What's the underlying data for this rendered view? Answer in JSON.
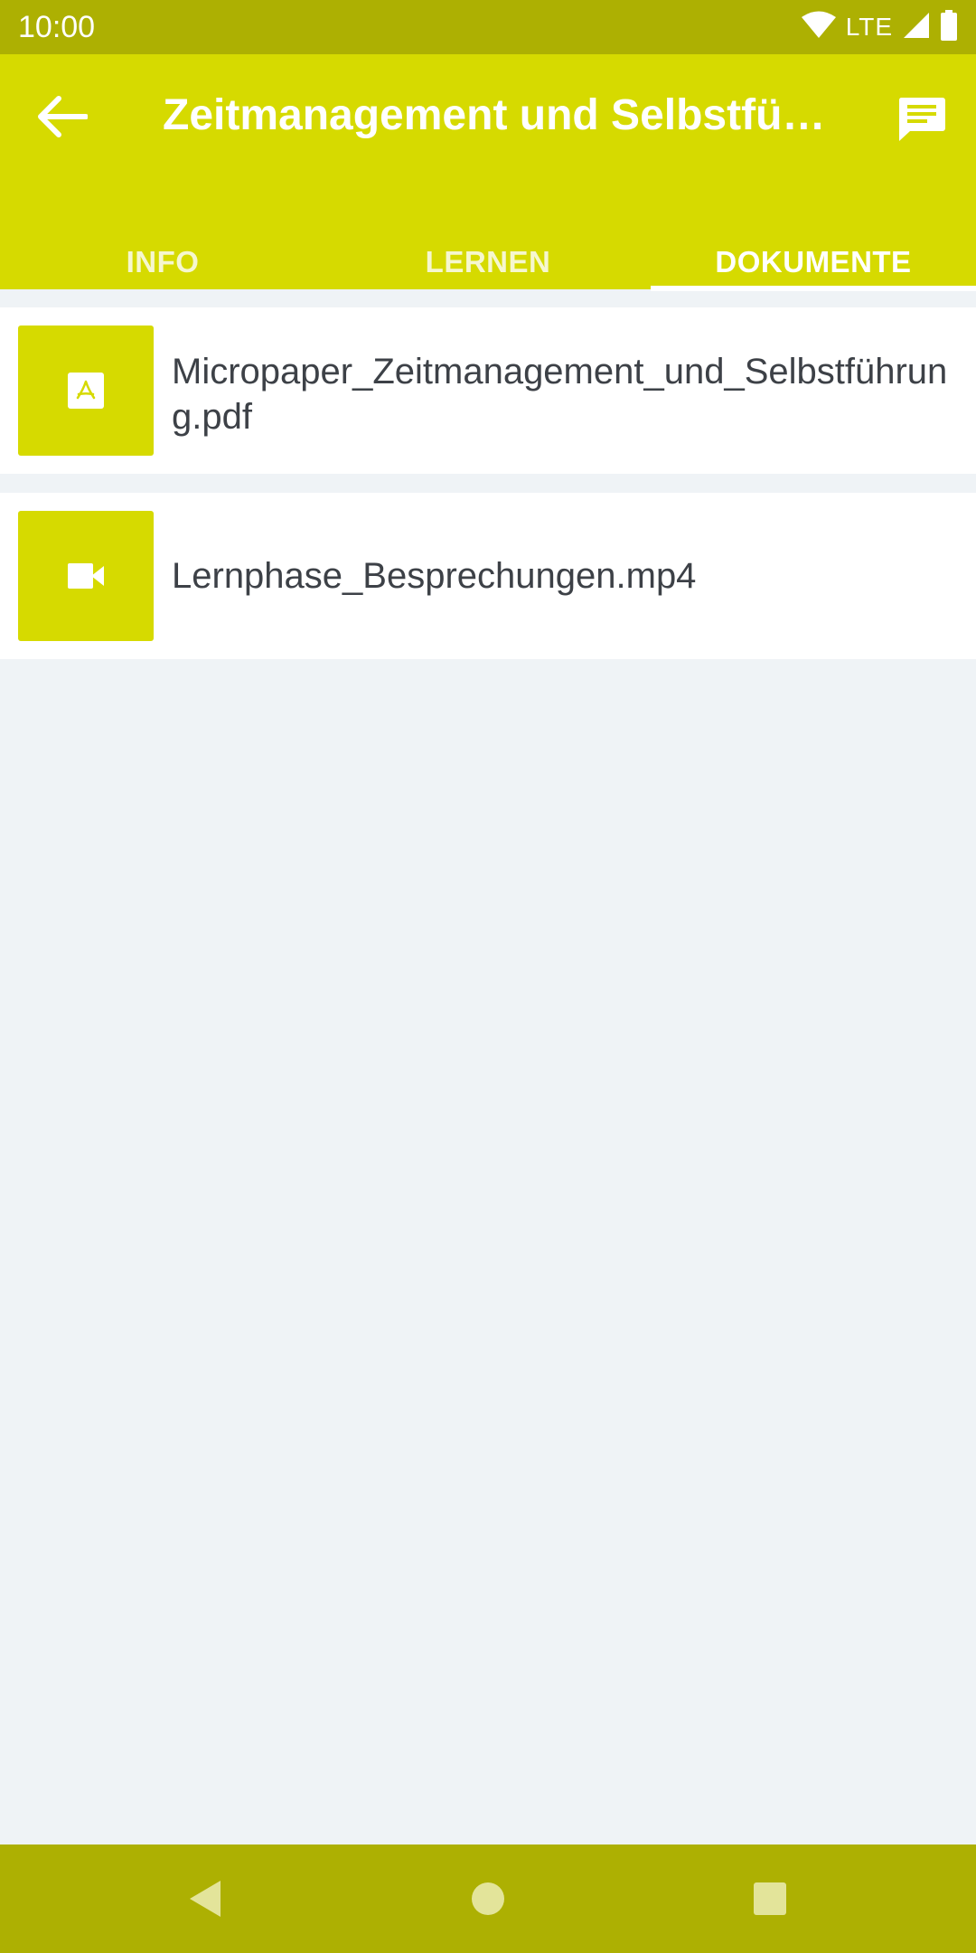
{
  "status_bar": {
    "time": "10:00",
    "network": "LTE"
  },
  "app_bar": {
    "title": "Zeitmanagement und Selbstführung",
    "back_icon": "arrow-back-icon",
    "chat_icon": "chat-icon"
  },
  "tabs": [
    {
      "label": "INFO",
      "active": false
    },
    {
      "label": "LERNEN",
      "active": false
    },
    {
      "label": "DOKUMENTE",
      "active": true
    }
  ],
  "documents": [
    {
      "name": "Micropaper_Zeitmanagement_und_Selbstführung.pdf",
      "icon": "pdf-icon"
    },
    {
      "name": "Lernphase_Besprechungen.mp4",
      "icon": "video-icon"
    }
  ],
  "colors": {
    "primary": "#d6da00",
    "primary_dark": "#adb002",
    "background": "#eff3f6"
  },
  "nav_bar": {
    "back_icon": "nav-back-icon",
    "home_icon": "nav-home-icon",
    "recents_icon": "nav-recents-icon"
  }
}
